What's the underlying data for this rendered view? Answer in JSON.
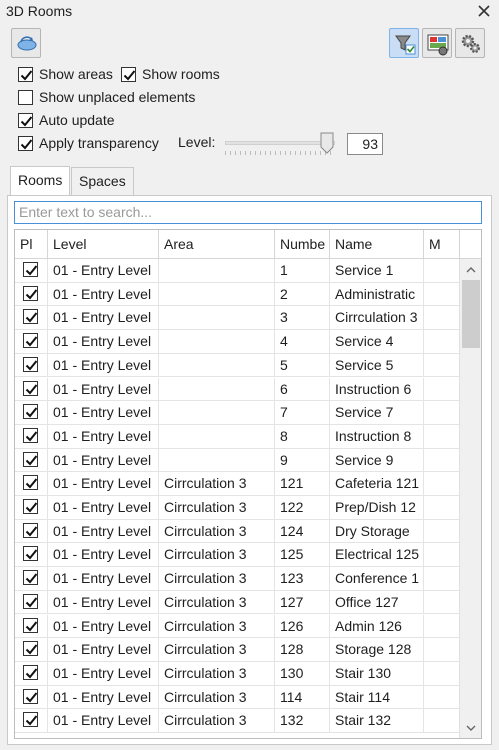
{
  "window": {
    "title": "3D Rooms"
  },
  "toolbar": {
    "refresh_icon": "refresh-icon",
    "filter_icon": "filter-icon",
    "display_icon": "display-settings-icon",
    "settings_icon": "gear-icon"
  },
  "options": {
    "show_areas": {
      "label": "Show areas",
      "checked": true
    },
    "show_rooms": {
      "label": "Show rooms",
      "checked": true
    },
    "show_unplaced": {
      "label": "Show unplaced elements",
      "checked": false
    },
    "auto_update": {
      "label": "Auto update",
      "checked": true
    },
    "apply_transparency": {
      "label": "Apply transparency",
      "checked": true
    },
    "level_label": "Level:",
    "level_value": "93",
    "level_fraction": 0.93
  },
  "tabs": [
    {
      "label": "Rooms",
      "selected": true
    },
    {
      "label": "Spaces",
      "selected": false
    }
  ],
  "search": {
    "placeholder": "Enter text to search..."
  },
  "table": {
    "columns": [
      "Pl",
      "Level",
      "Area",
      "Numbe",
      "Name",
      "M"
    ],
    "rows": [
      {
        "placed": true,
        "level": "01 - Entry Level",
        "area": "",
        "number": "1",
        "name": "Service 1"
      },
      {
        "placed": true,
        "level": "01 - Entry Level",
        "area": "",
        "number": "2",
        "name": "Administratic"
      },
      {
        "placed": true,
        "level": "01 - Entry Level",
        "area": "",
        "number": "3",
        "name": "Cirrculation 3"
      },
      {
        "placed": true,
        "level": "01 - Entry Level",
        "area": "",
        "number": "4",
        "name": "Service 4"
      },
      {
        "placed": true,
        "level": "01 - Entry Level",
        "area": "",
        "number": "5",
        "name": "Service 5"
      },
      {
        "placed": true,
        "level": "01 - Entry Level",
        "area": "",
        "number": "6",
        "name": "Instruction 6"
      },
      {
        "placed": true,
        "level": "01 - Entry Level",
        "area": "",
        "number": "7",
        "name": "Service 7"
      },
      {
        "placed": true,
        "level": "01 - Entry Level",
        "area": "",
        "number": "8",
        "name": "Instruction 8"
      },
      {
        "placed": true,
        "level": "01 - Entry Level",
        "area": "",
        "number": "9",
        "name": "Service 9"
      },
      {
        "placed": true,
        "level": "01 - Entry Level",
        "area": "Cirrculation 3",
        "number": "121",
        "name": "Cafeteria 121"
      },
      {
        "placed": true,
        "level": "01 - Entry Level",
        "area": "Cirrculation 3",
        "number": "122",
        "name": "Prep/Dish 12"
      },
      {
        "placed": true,
        "level": "01 - Entry Level",
        "area": "Cirrculation 3",
        "number": "124",
        "name": "Dry Storage"
      },
      {
        "placed": true,
        "level": "01 - Entry Level",
        "area": "Cirrculation 3",
        "number": "125",
        "name": "Electrical 125"
      },
      {
        "placed": true,
        "level": "01 - Entry Level",
        "area": "Cirrculation 3",
        "number": "123",
        "name": "Conference 1"
      },
      {
        "placed": true,
        "level": "01 - Entry Level",
        "area": "Cirrculation 3",
        "number": "127",
        "name": "Office 127"
      },
      {
        "placed": true,
        "level": "01 - Entry Level",
        "area": "Cirrculation 3",
        "number": "126",
        "name": "Admin 126"
      },
      {
        "placed": true,
        "level": "01 - Entry Level",
        "area": "Cirrculation 3",
        "number": "128",
        "name": "Storage 128"
      },
      {
        "placed": true,
        "level": "01 - Entry Level",
        "area": "Cirrculation 3",
        "number": "130",
        "name": "Stair 130"
      },
      {
        "placed": true,
        "level": "01 - Entry Level",
        "area": "Cirrculation 3",
        "number": "114",
        "name": "Stair 114"
      },
      {
        "placed": true,
        "level": "01 - Entry Level",
        "area": "Cirrculation 3",
        "number": "132",
        "name": "Stair 132"
      }
    ]
  },
  "colors": {
    "accent": "#4a90d9",
    "active_button": "#c9def5"
  }
}
